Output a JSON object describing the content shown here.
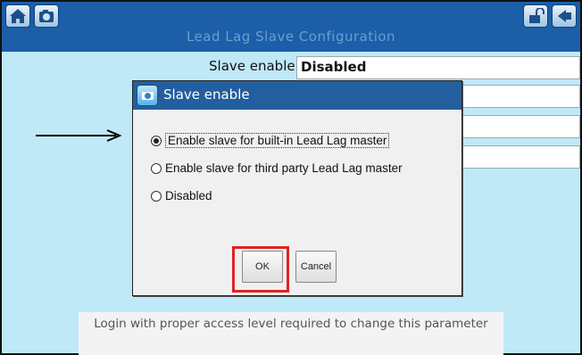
{
  "header": {
    "title": "Lead Lag Slave Configuration",
    "left_icons": [
      "home-icon",
      "camera-icon"
    ],
    "right_icons": [
      "unlock-icon",
      "back-arrow-icon"
    ]
  },
  "main": {
    "slave_enable_label": "Slave enable",
    "slave_enable_value": "Disabled",
    "login_note": "Login with proper access level required to change this parameter"
  },
  "dialog": {
    "title": "Slave enable",
    "options": [
      {
        "label": "Enable slave for built-in Lead Lag master",
        "selected": true
      },
      {
        "label": "Enable slave for third party Lead Lag master",
        "selected": false
      },
      {
        "label": "Disabled",
        "selected": false
      }
    ],
    "ok_label": "OK",
    "cancel_label": "Cancel"
  },
  "colors": {
    "titlebar": "#1c5ea8",
    "background": "#bfe9f7",
    "highlight": "#e02222"
  }
}
